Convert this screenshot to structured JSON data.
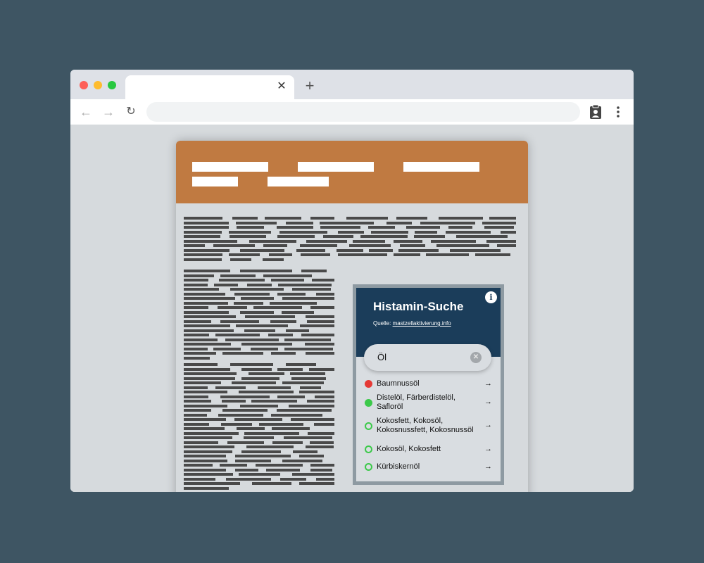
{
  "browser": {
    "tab_close_glyph": "✕",
    "new_tab_glyph": "+",
    "back_glyph": "←",
    "forward_glyph": "→",
    "reload_glyph": "↻",
    "extension_icon": "clipboard-user-icon",
    "menu_icon": "vertical-dots-icon"
  },
  "page": {
    "header_color": "#c07a41",
    "nav_item_count_visible": 5
  },
  "widget": {
    "title": "Histamin-Suche",
    "source_prefix": "Quelle: ",
    "source_link": "mastzellaktivierung.info",
    "info_glyph": "i",
    "search_value": "Öl",
    "clear_glyph": "✕",
    "header_color": "#1b3d5a",
    "results": [
      {
        "label": "Baumnussöl",
        "status": "red",
        "arrow": "→"
      },
      {
        "label": "Distelöl, Färberdistelöl, Safloröl",
        "status": "green",
        "arrow": "→"
      },
      {
        "label": "Kokosfett, Kokosöl, Kokosnussfett, Kokosnussöl",
        "status": "green-outline",
        "arrow": "→"
      },
      {
        "label": "Kokosöl, Kokosfett",
        "status": "green-outline",
        "arrow": "→"
      },
      {
        "label": "Kürbiskernöl",
        "status": "green-outline",
        "arrow": "→"
      }
    ]
  }
}
